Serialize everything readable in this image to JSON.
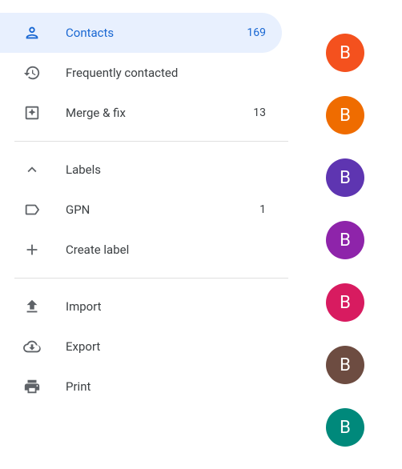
{
  "sidebar": {
    "contacts": {
      "label": "Contacts",
      "count": "169"
    },
    "frequent": {
      "label": "Frequently contacted"
    },
    "mergefix": {
      "label": "Merge & fix",
      "count": "13"
    },
    "labels_header": {
      "label": "Labels"
    },
    "label_gpn": {
      "label": "GPN",
      "count": "1"
    },
    "create_label": {
      "label": "Create label"
    },
    "import": {
      "label": "Import"
    },
    "export": {
      "label": "Export"
    },
    "print": {
      "label": "Print"
    }
  },
  "avatars": [
    {
      "initial": "B",
      "color": "#f4511e"
    },
    {
      "initial": "B",
      "color": "#ef6c00"
    },
    {
      "initial": "B",
      "color": "#5e35b1"
    },
    {
      "initial": "B",
      "color": "#8e24aa"
    },
    {
      "initial": "B",
      "color": "#d81b60"
    },
    {
      "initial": "B",
      "color": "#6d4c41"
    },
    {
      "initial": "B",
      "color": "#00897b"
    }
  ]
}
